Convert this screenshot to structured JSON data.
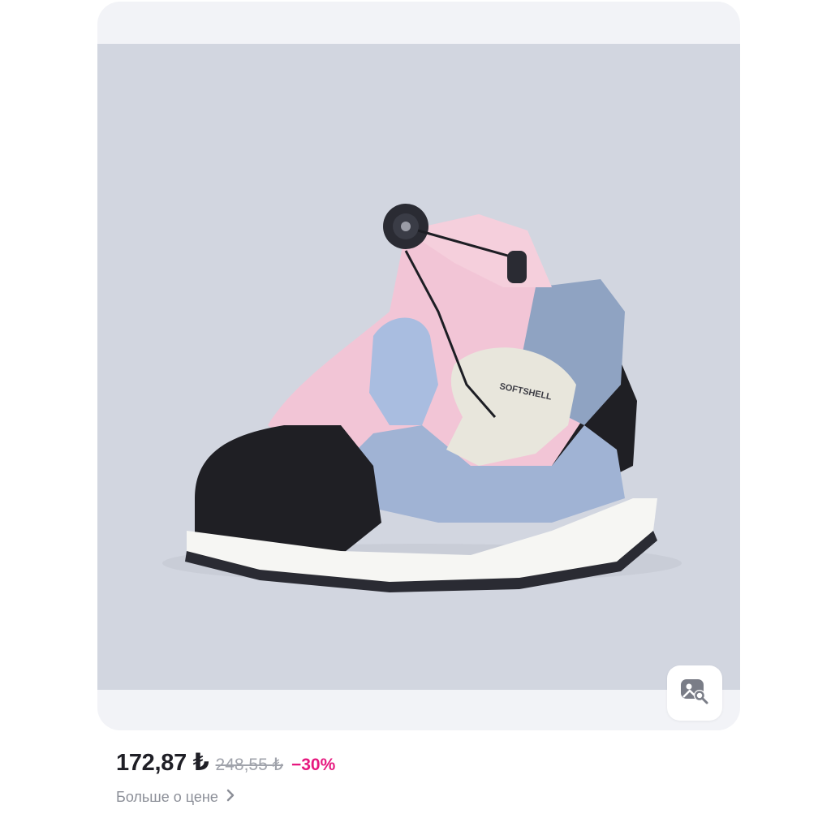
{
  "product": {
    "image_alt": "SOFTSHELL",
    "visual_search_icon": "image-search-icon"
  },
  "price": {
    "current": "172,87 ₺",
    "old": "248,55 ₺",
    "discount": "−30%"
  },
  "more_price": {
    "label": "Больше о цене",
    "icon": "chevron-right-icon"
  },
  "colors": {
    "discount": "#e6187f",
    "price": "#1f1f26",
    "old_price": "#a0a3ab",
    "card_bg": "#f2f3f7"
  }
}
